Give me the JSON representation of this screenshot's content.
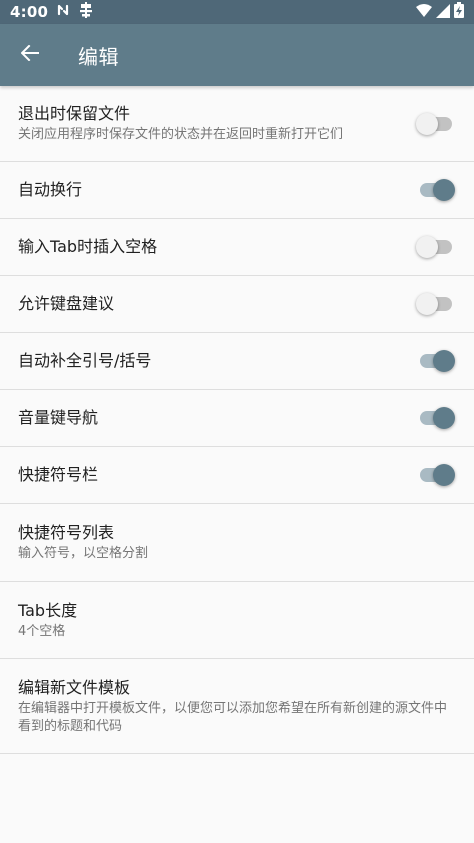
{
  "status_bar": {
    "time": "4:00"
  },
  "app_bar": {
    "title": "编辑"
  },
  "colors": {
    "status_bar": "#4f6878",
    "app_bar": "#5f7c8a",
    "switch_on": "#5f7c8a",
    "switch_on_track": "#a9bac3",
    "switch_off_track": "#c2c2c2"
  },
  "settings": [
    {
      "title": "退出时保留文件",
      "summary": "关闭应用程序时保存文件的状态并在返回时重新打开它们",
      "toggle": false
    },
    {
      "title": "自动换行",
      "toggle": true
    },
    {
      "title": "输入Tab时插入空格",
      "toggle": false
    },
    {
      "title": "允许键盘建议",
      "toggle": false
    },
    {
      "title": "自动补全引号/括号",
      "toggle": true
    },
    {
      "title": "音量键导航",
      "toggle": true
    },
    {
      "title": "快捷符号栏",
      "toggle": true
    },
    {
      "title": "快捷符号列表",
      "summary": "输入符号，以空格分割"
    },
    {
      "title": "Tab长度",
      "summary": "4个空格"
    },
    {
      "title": "编辑新文件模板",
      "summary": "在编辑器中打开模板文件，以便您可以添加您希望在所有新创建的源文件中看到的标题和代码"
    }
  ]
}
